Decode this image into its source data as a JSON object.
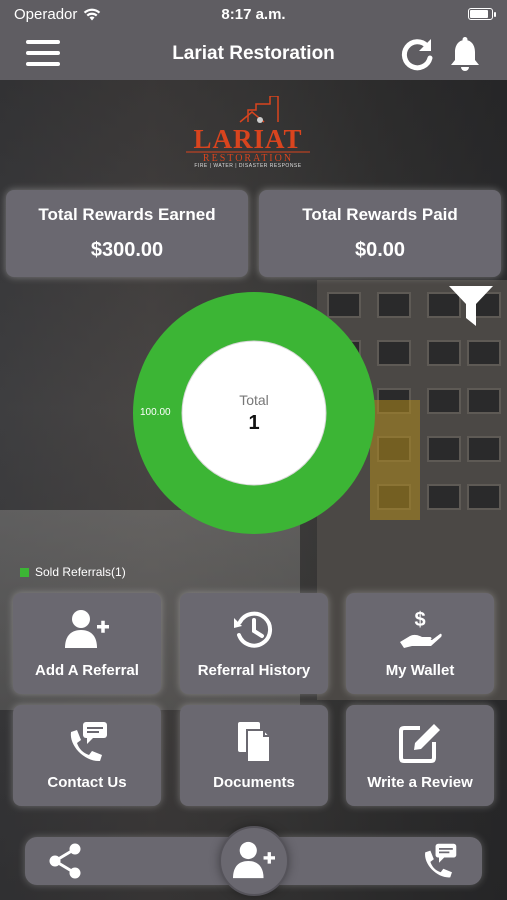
{
  "status_bar": {
    "carrier": "Operador",
    "time": "8:17 a.m."
  },
  "navbar": {
    "title": "Lariat Restoration"
  },
  "logo": {
    "name": "LARIAT",
    "sub": "RESTORATION",
    "tagline": "FIRE | WATER | DISASTER RESPONSE"
  },
  "rewards": {
    "earned_label": "Total Rewards Earned",
    "earned_value": "$300.00",
    "paid_label": "Total Rewards Paid",
    "paid_value": "$0.00"
  },
  "chart_data": {
    "type": "pie",
    "variant": "donut",
    "categories": [
      "Sold Referrals"
    ],
    "values": [
      100.0
    ],
    "slice_label": "100.00",
    "center_label": "Total",
    "center_value": "1",
    "legend": [
      "Sold Referrals(1)"
    ],
    "legend_placement": "bottom-left",
    "colors": [
      "#3cb535"
    ]
  },
  "tiles": [
    {
      "label": "Add A Referral",
      "icon": "add-user-icon"
    },
    {
      "label": "Referral History",
      "icon": "history-icon"
    },
    {
      "label": "My Wallet",
      "icon": "wallet-icon"
    },
    {
      "label": "Contact Us",
      "icon": "contact-icon"
    },
    {
      "label": "Documents",
      "icon": "documents-icon"
    },
    {
      "label": "Write a Review",
      "icon": "write-review-icon"
    }
  ],
  "bottom_bar": {
    "left_icon": "share-icon",
    "center_icon": "add-user-icon",
    "right_icon": "contact-icon"
  },
  "colors": {
    "bar": "#5f5d62",
    "card": "#6a6870",
    "accent_green": "#3cb535",
    "logo_orange": "#d9441e"
  }
}
